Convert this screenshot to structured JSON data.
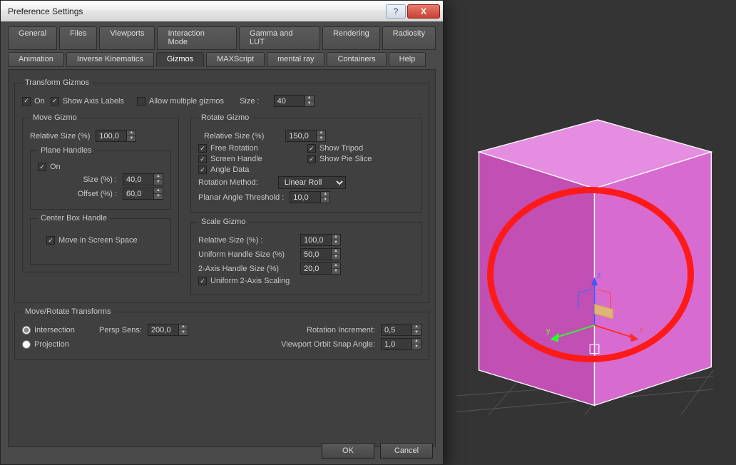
{
  "title": "Preference Settings",
  "window_buttons": {
    "help": "?",
    "close": "X"
  },
  "tabs_row1": [
    "General",
    "Files",
    "Viewports",
    "Interaction Mode",
    "Gamma and LUT",
    "Rendering",
    "Radiosity"
  ],
  "tabs_row2": [
    "Animation",
    "Inverse Kinematics",
    "Gizmos",
    "MAXScript",
    "mental ray",
    "Containers",
    "Help"
  ],
  "active_tab": "Gizmos",
  "transform_gizmos": {
    "legend": "Transform Gizmos",
    "on": {
      "label": "On",
      "checked": true
    },
    "show_axis": {
      "label": "Show Axis Labels",
      "checked": true
    },
    "allow_multiple": {
      "label": "Allow multiple gizmos",
      "checked": false
    },
    "size_label": "Size :",
    "size_value": "40"
  },
  "move_gizmo": {
    "legend": "Move Gizmo",
    "relative_size_label": "Relative Size (%)",
    "relative_size_value": "100,0",
    "plane_handles": {
      "legend": "Plane Handles",
      "on": {
        "label": "On",
        "checked": true
      },
      "size_label": "Size (%) :",
      "size_value": "40,0",
      "offset_label": "Offset (%) :",
      "offset_value": "60,0"
    },
    "center_box": {
      "legend": "Center Box Handle",
      "move_in_screen": {
        "label": "Move in Screen Space",
        "checked": true
      }
    }
  },
  "rotate_gizmo": {
    "legend": "Rotate Gizmo",
    "relative_size_label": "Relative Size (%)",
    "relative_size_value": "150,0",
    "free_rotation": {
      "label": "Free Rotation",
      "checked": true
    },
    "show_tripod": {
      "label": "Show Tripod",
      "checked": true
    },
    "screen_handle": {
      "label": "Screen Handle",
      "checked": true
    },
    "show_pie_slice": {
      "label": "Show Pie Slice",
      "checked": true
    },
    "angle_data": {
      "label": "Angle Data",
      "checked": true
    },
    "rotation_method_label": "Rotation Method:",
    "rotation_method_value": "Linear Roll",
    "planar_angle_label": "Planar Angle Threshold :",
    "planar_angle_value": "10,0"
  },
  "scale_gizmo": {
    "legend": "Scale Gizmo",
    "relative_size_label": "Relative Size (%) :",
    "relative_size_value": "100,0",
    "uniform_size_label": "Uniform Handle Size (%)",
    "uniform_size_value": "50,0",
    "two_axis_size_label": "2-Axis Handle Size (%)",
    "two_axis_size_value": "20,0",
    "uniform_2axis": {
      "label": "Uniform 2-Axis Scaling",
      "checked": true
    }
  },
  "move_rotate": {
    "legend": "Move/Rotate Transforms",
    "intersection": {
      "label": "Intersection",
      "checked": true
    },
    "projection": {
      "label": "Projection",
      "checked": false
    },
    "persp_sens_label": "Persp Sens:",
    "persp_sens_value": "200,0",
    "rotation_incr_label": "Rotation Increment:",
    "rotation_incr_value": "0,5",
    "orbit_snap_label": "Viewport Orbit Snap Angle:",
    "orbit_snap_value": "1,0"
  },
  "buttons": {
    "ok": "OK",
    "cancel": "Cancel"
  },
  "gizmo_axes": {
    "x": "x",
    "y": "y",
    "z": "z"
  }
}
